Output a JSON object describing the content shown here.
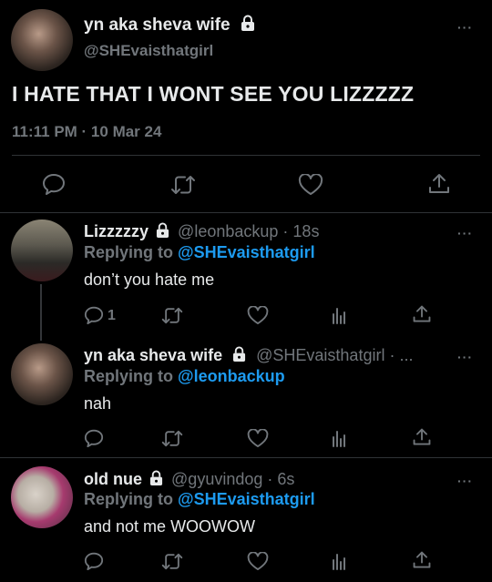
{
  "main_tweet": {
    "display_name": "yn aka sheva wife",
    "handle": "@SHEvaisthatgirl",
    "text": "I HATE THAT I WONT SEE YOU LIZZZZZ",
    "timestamp": "11:11 PM · 10 Mar 24",
    "more": "···"
  },
  "replies": [
    {
      "display_name": "Lizzzzzy",
      "handle": "@leonbackup",
      "time": "· 18s",
      "replying_prefix": "Replying to",
      "replying_to": "@SHEvaisthatgirl",
      "text": "don’t you hate me",
      "reply_count": "1",
      "more": "···"
    },
    {
      "display_name": "yn aka sheva wife",
      "handle": "@SHEvaisthatgirl · ...",
      "replying_prefix": "Replying to",
      "replying_to": "@leonbackup",
      "text": "nah",
      "more": "···"
    },
    {
      "display_name": "old nue",
      "handle": "@gyuvindog",
      "time": "· 6s",
      "replying_prefix": "Replying to",
      "replying_to": "@SHEvaisthatgirl",
      "text": "and not me WOOWOW",
      "more": "···"
    }
  ],
  "colors": {
    "background": "#000000",
    "text": "#e7e9ea",
    "secondary": "#71767b",
    "link": "#1d9bf0",
    "divider": "#2f3336"
  },
  "icons": [
    "reply-icon",
    "retweet-icon",
    "like-icon",
    "share-icon",
    "analytics-icon",
    "lock-icon",
    "more-icon"
  ]
}
